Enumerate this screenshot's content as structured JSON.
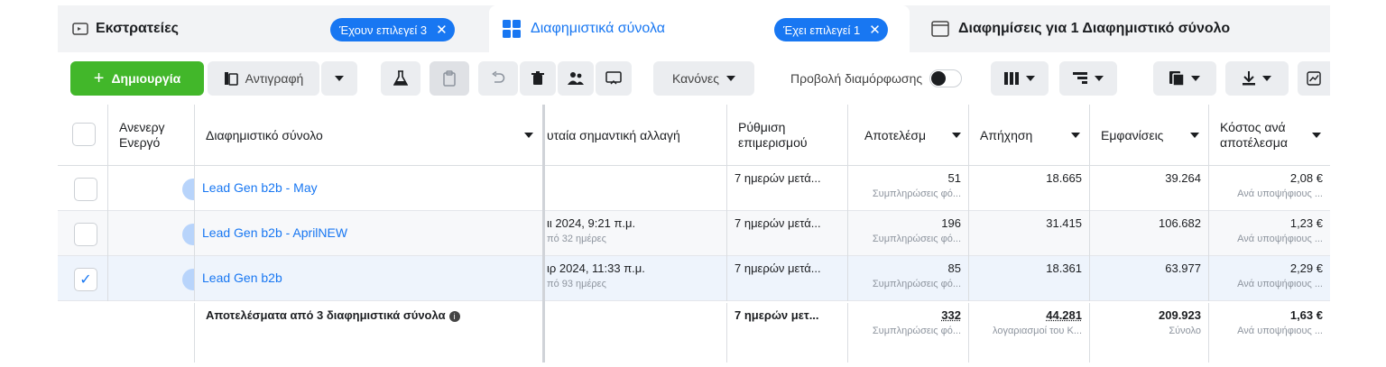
{
  "tabs": {
    "campaigns": {
      "label": "Εκστρατείες",
      "pill": "Έχουν επιλεγεί 3",
      "icon": "folder-icon"
    },
    "adsets": {
      "label": "Διαφημιστικά σύνολα",
      "pill": "Έχει επιλεγεί 1",
      "icon": "grid-icon"
    },
    "ads": {
      "label": "Διαφημίσεις για 1 Διαφημιστικό σύνολο",
      "icon": "ad-icon"
    }
  },
  "toolbar": {
    "create_label": "Δημιουργία",
    "copy_label": "Αντιγραφή",
    "rules_label": "Κανόνες",
    "view_setup_label": "Προβολή διαμόρφωσης"
  },
  "table": {
    "headers": {
      "toggle": "Ανενεργό / Ενεργό",
      "toggle_line1": "Ανενεργ",
      "toggle_line2": "Ενεργό",
      "name": "Διαφημιστικό σύνολο",
      "last_change": "υταία σημαντική αλλαγή",
      "attribution_line1": "Ρύθμιση",
      "attribution_line2": "επιμερισμού",
      "results": "Αποτελέσμ",
      "reach": "Απήχηση",
      "impressions": "Εμφανίσεις",
      "cost_line1": "Κόστος ανά",
      "cost_line2": "αποτέλεσμα"
    },
    "rows": [
      {
        "name": "Lead Gen b2b - May",
        "last_change": "",
        "last_change_sub": "",
        "attribution": "7 ημερών μετά...",
        "results": "51",
        "results_sub": "Συμπληρώσεις φό...",
        "reach": "18.665",
        "impressions": "39.264",
        "cost": "2,08 €",
        "cost_sub": "Ανά υποψήφιους ..."
      },
      {
        "name": "Lead Gen b2b - AprilNEW",
        "last_change": "ιι 2024, 9:21 π.μ.",
        "last_change_sub": "πό 32 ημέρες",
        "attribution": "7 ημερών μετά...",
        "results": "196",
        "results_sub": "Συμπληρώσεις φό...",
        "reach": "31.415",
        "impressions": "106.682",
        "cost": "1,23 €",
        "cost_sub": "Ανά υποψήφιους ..."
      },
      {
        "name": "Lead Gen b2b",
        "last_change": "ιρ 2024, 11:33 π.μ.",
        "last_change_sub": "πό 93 ημέρες",
        "attribution": "7 ημερών μετά...",
        "results": "85",
        "results_sub": "Συμπληρώσεις φό...",
        "reach": "18.361",
        "impressions": "63.977",
        "cost": "2,29 €",
        "cost_sub": "Ανά υποψήφιους ..."
      }
    ],
    "totals": {
      "label": "Αποτελέσματα από 3 διαφημιστικά σύνολα",
      "attribution": "7 ημερών μετ...",
      "results": "332",
      "results_sub": "Συμπληρώσεις φό...",
      "reach": "44.281",
      "reach_sub": "λογαριασμοί του Κ...",
      "impressions": "209.923",
      "impressions_sub": "Σύνολο",
      "cost": "1,63 €",
      "cost_sub": "Ανά υποψήφιους ..."
    }
  },
  "colors": {
    "accent": "#1877f2",
    "create": "#42b72a"
  }
}
